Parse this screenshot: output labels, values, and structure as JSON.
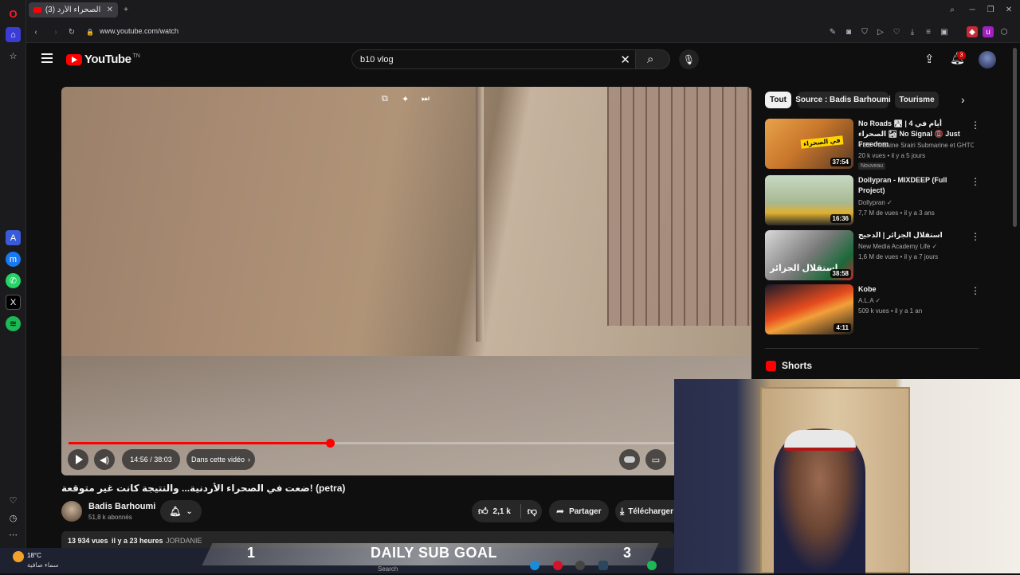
{
  "browser": {
    "tab_title": "(3) ضعت في الصحراء الأرد",
    "url": "www.youtube.com/watch"
  },
  "youtube": {
    "logo_text": "YouTube",
    "logo_country": "TN",
    "search_value": "b10 vlog",
    "notification_count": "3"
  },
  "player": {
    "time_display": "14:56 / 38:03",
    "chapter_label": "Dans cette vidéo",
    "progress_fraction": 0.431
  },
  "video": {
    "title": "ضعت في الصحراء الأردنية... والنتيجة كانت غير متوقعة! (petra)",
    "channel_name": "Badis Barhoumi",
    "subscribers": "51,8 k abonnés",
    "likes": "2,1 k",
    "share_label": "Partager",
    "download_label": "Télécharger",
    "views": "13 934 vues",
    "posted": "il y a 23 heures",
    "hashtag": "JORDANIE"
  },
  "chips": [
    "Tout",
    "Source : Badis Barhoumi",
    "Tourisme"
  ],
  "recommendations": [
    {
      "title": "No Roads 🛣 | 4 أيام في الصحراء 🏜 No Signal 📵 Just Freedom",
      "channel": "YSS - Yassine Srairi Submarine et GHTC...",
      "meta": "20 k vues • il y a 5 jours",
      "badge": "Nouveau",
      "duration": "37:54",
      "thumb_caption": "في الصحراء"
    },
    {
      "title": "Dollypran - MIXDEEP (Full Project)",
      "channel": "Dollypran",
      "meta": "7,7 M de vues • il y a 3 ans",
      "badge": "",
      "duration": "16:36",
      "thumb_caption": ""
    },
    {
      "title": "استقلال الجزائر | الدحيح",
      "channel": "New Media Academy Life",
      "meta": "1,6 M de vues • il y a 7 jours",
      "badge": "",
      "duration": "38:58",
      "thumb_caption": "استقلال الجزائر"
    },
    {
      "title": "Kobe",
      "channel": "A.L.A",
      "meta": "509 k vues • il y a 1 an",
      "badge": "",
      "duration": "4:11",
      "thumb_caption": ""
    }
  ],
  "shorts_label": "Shorts",
  "overlay": {
    "goal_current": "1",
    "goal_label": "DAILY SUB GOAL",
    "goal_target": "3"
  },
  "taskbar": {
    "temperature": "18°C",
    "weather": "سماء صافية",
    "search_placeholder": "Search"
  },
  "colors": {
    "accent_red": "#ff0000",
    "background": "#0f0f0f",
    "surface": "#272727"
  }
}
